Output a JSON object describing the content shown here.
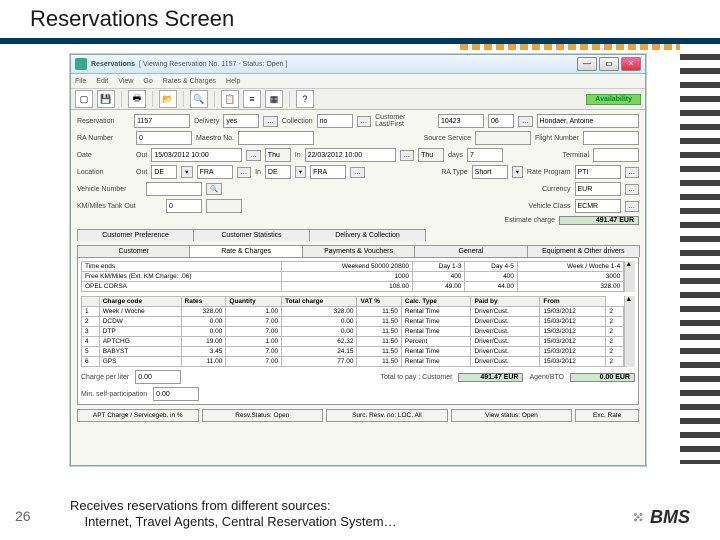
{
  "slide": {
    "title": "Reservations Screen",
    "page_num": "26",
    "caption_line1": "Receives reservations from different sources:",
    "caption_line2": "Internet, Travel Agents, Central Reservation System…",
    "logo": "BMS"
  },
  "window": {
    "title_prefix": "Reservations",
    "title_status": "[ Viewing   Reservation  No. 1157  -  Status: Open ]",
    "min": "—",
    "max": "▭",
    "close": "✕",
    "menu": [
      "File",
      "Edit",
      "View",
      "Go",
      "Rates & Charges",
      "Help"
    ],
    "avail_btn": "Availability"
  },
  "header": {
    "res_lbl": "Reservation",
    "res_val": "1157",
    "deliv_lbl": "Delivery",
    "deliv_val": "yes",
    "coll_lbl": "Collection",
    "coll_val": "no",
    "cust_lbl": "Customer Last/First",
    "cust_id": "10423",
    "cust_code": "06",
    "cust_name": "Hondaer, Antoine",
    "ra_lbl": "RA Number",
    "ra_val": "0",
    "maestro_lbl": "Maestro No.",
    "maestro_val": "",
    "src_lbl": "Source Service",
    "flight_lbl": "Flight Number",
    "date_lbl": "Date",
    "out_lbl": "Out",
    "out_val": "15/03/2012 10:00",
    "out_dow": "Thu",
    "in_lbl": "In",
    "in_val": "22/03/2012 10:00",
    "in_dow": "Thu",
    "days_lbl": "days",
    "days_val": "7",
    "term_lbl": "Terminal",
    "loc_lbl": "Location",
    "loc_out_c": "DE",
    "loc_out_s": "FRA",
    "loc_in_c": "DE",
    "loc_in_s": "FRA",
    "ratype_lbl": "RA Type",
    "ratype_val": "Short",
    "rateprog_lbl": "Rate Program",
    "rateprog_val": "PTI",
    "veh_lbl": "Vehicle Number",
    "currency_lbl": "Currency",
    "currency_val": "EUR",
    "km_lbl": "KM/Miles   Tank   Out",
    "km_val": "0",
    "vclass_lbl": "Vehicle Class",
    "vclass_val": "ECMR",
    "est_lbl": "Estimate charge",
    "est_val": "491.47 EUR"
  },
  "tabs": {
    "t1": "Customer Preference",
    "t2": "Customer Statistics",
    "t3": "Delivery & Collection",
    "m1": "Customer",
    "m2": "Rate & Charges",
    "m3": "Payments & Vouchers",
    "m4": "General",
    "m5": "Equipment & Other drivers"
  },
  "inner_table": {
    "rows": [
      [
        "Time ends",
        "Weekend 50000 20800",
        "Day 1-3",
        "Day 4-5",
        "Week / Woche 1-4"
      ],
      [
        "Free KM/Miles (Ext. KM Charge: .06)",
        "1000",
        "400",
        "400",
        "3000"
      ],
      [
        "OPEL CORSA",
        "108.00",
        "49.00",
        "44.00",
        "328.00"
      ]
    ]
  },
  "charges_table": {
    "cols": [
      "",
      "Charge code",
      "Rates",
      "Quantity",
      "Total charge",
      "VAT %",
      "Calc. Type",
      "Paid by",
      "From"
    ],
    "rows": [
      [
        "1",
        "Week / Woche",
        "328.00",
        "1.00",
        "328.00",
        "11.50",
        "Rental Time",
        "Driver/Cust.",
        "15/03/2012",
        "2"
      ],
      [
        "2",
        "DCDW",
        "0.00",
        "7.00",
        "0.00",
        "11.50",
        "Rental Time",
        "Driver/Cust.",
        "15/03/2012",
        "2"
      ],
      [
        "3",
        "DTP",
        "0.00",
        "7.00",
        "0.00",
        "11.50",
        "Rental Time",
        "Driver/Cust.",
        "15/03/2012",
        "2"
      ],
      [
        "4",
        "APTCHG",
        "19.00",
        "1.00",
        "62.32",
        "11.50",
        "Percent",
        "Driver/Cust.",
        "15/03/2012",
        "2"
      ],
      [
        "5",
        "BABYST",
        "3.45",
        "7.00",
        "24.15",
        "11.50",
        "Rental Time",
        "Driver/Cust.",
        "15/03/2012",
        "2"
      ],
      [
        "6",
        "GPS",
        "11.00",
        "7.00",
        "77.00",
        "11.50",
        "Rental Time",
        "Driver/Cust.",
        "15/03/2012",
        "2"
      ]
    ]
  },
  "totals": {
    "cpl_lbl": "Charge per liter",
    "cpl_val": "0.00",
    "self_lbl": "Min. self-participation",
    "self_val": "0.00",
    "total_lbl": "Total to pay : Customer",
    "total_val": "491.47 EUR",
    "agent_lbl": "Agent/BTO",
    "agent_val": "0.00 EUR"
  },
  "footer": {
    "b1": "APT Charge / Servicegeb. in %",
    "b2": "Resv.Status: Open",
    "b3": "Surc. Resv. no: LOC. All",
    "b4": "View status: Open",
    "b5": "Exc. Rate"
  }
}
